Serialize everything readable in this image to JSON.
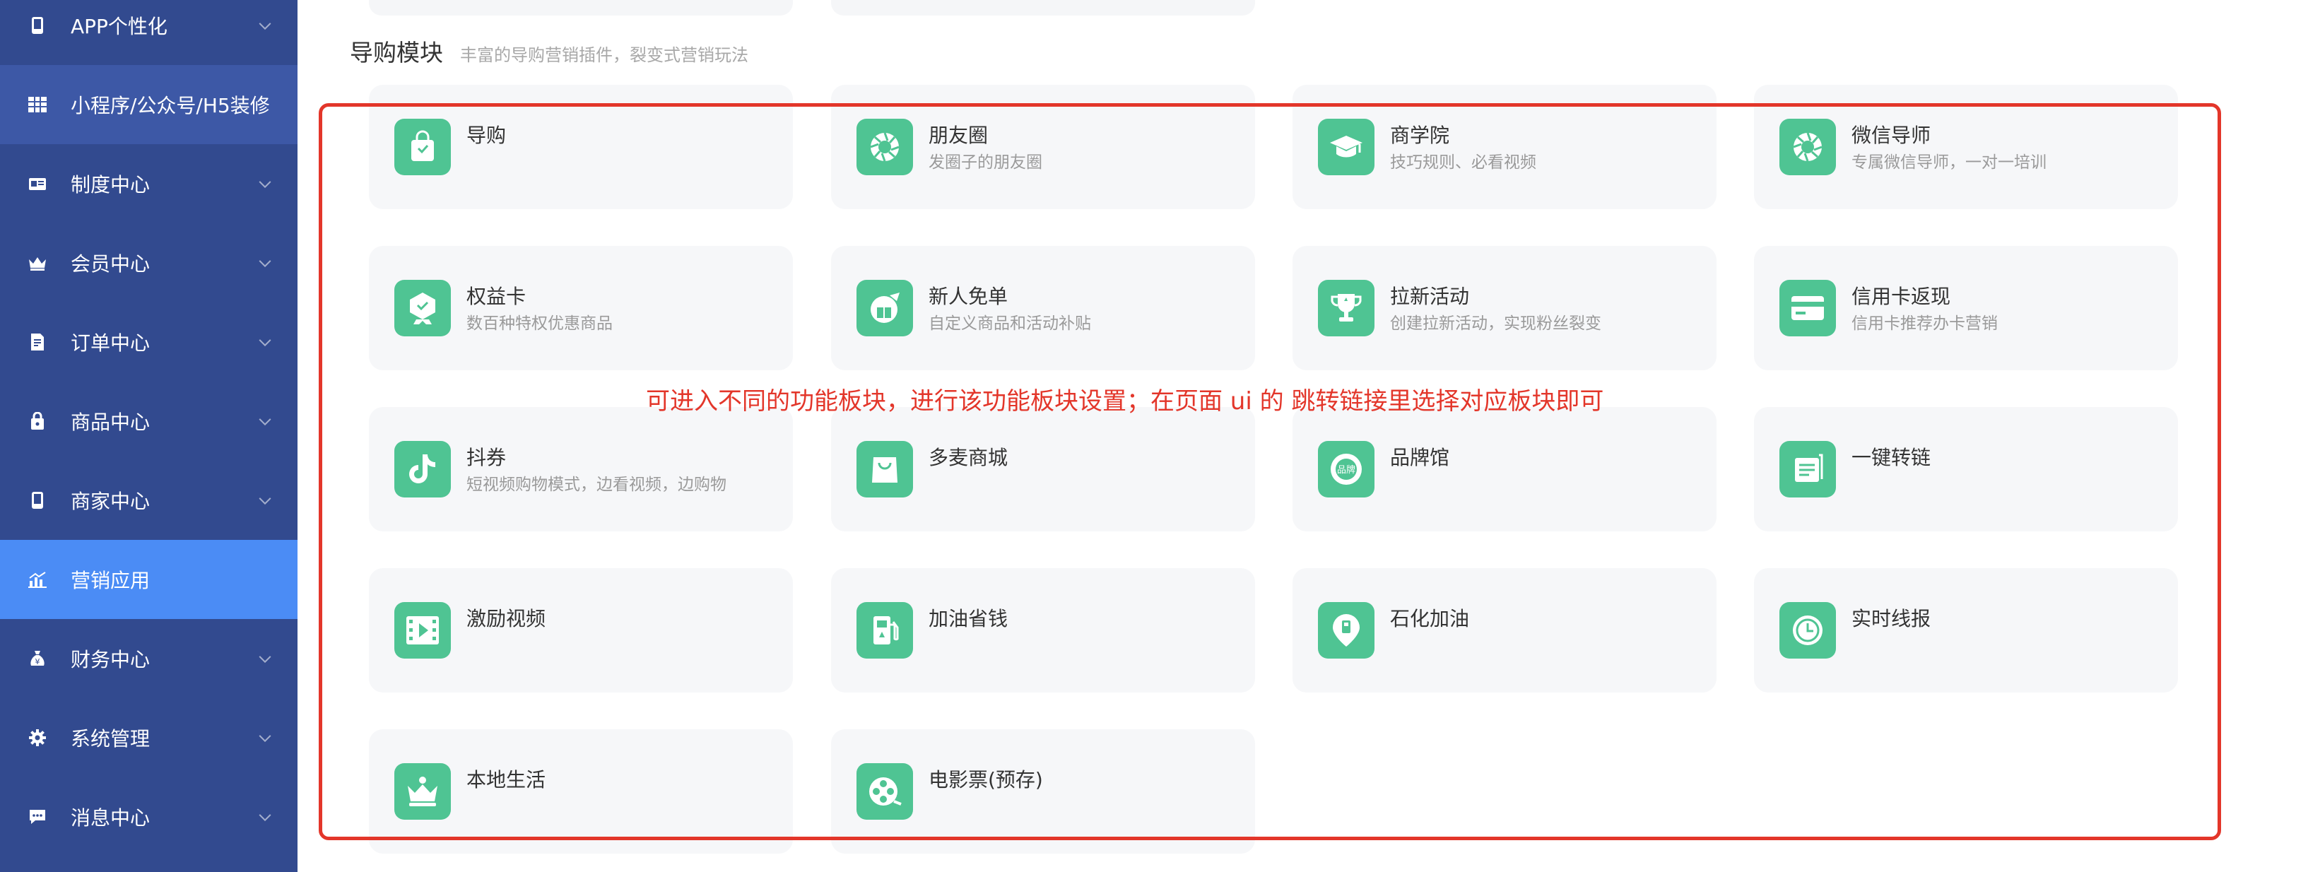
{
  "sidebar": {
    "items": [
      {
        "label": "APP个性化",
        "icon": "phone-icon",
        "chevron": true
      },
      {
        "label": "小程序/公众号/H5装修",
        "icon": "grid-icon",
        "chevron": false
      },
      {
        "label": "制度中心",
        "icon": "id-card-icon",
        "chevron": true
      },
      {
        "label": "会员中心",
        "icon": "crown-icon",
        "chevron": true
      },
      {
        "label": "订单中心",
        "icon": "document-icon",
        "chevron": true
      },
      {
        "label": "商品中心",
        "icon": "bag-icon",
        "chevron": true
      },
      {
        "label": "商家中心",
        "icon": "phone-icon",
        "chevron": true
      },
      {
        "label": "营销应用",
        "icon": "chart-icon",
        "chevron": false,
        "active": true
      },
      {
        "label": "财务中心",
        "icon": "money-bag-icon",
        "chevron": true
      },
      {
        "label": "系统管理",
        "icon": "gear-icon",
        "chevron": true
      },
      {
        "label": "消息中心",
        "icon": "chat-icon",
        "chevron": true
      }
    ]
  },
  "section": {
    "title": "导购模块",
    "subtitle": "丰富的导购营销插件，裂变式营销玩法"
  },
  "cards": [
    {
      "title": "导购",
      "desc": "",
      "icon": "shopping-bag-icon"
    },
    {
      "title": "朋友圈",
      "desc": "发圈子的朋友圈",
      "icon": "aperture-icon"
    },
    {
      "title": "商学院",
      "desc": "技巧规则、必看视频",
      "icon": "graduation-cap-icon"
    },
    {
      "title": "微信导师",
      "desc": "专属微信导师，一对一培训",
      "icon": "aperture-icon"
    },
    {
      "title": "权益卡",
      "desc": "数百种特权优惠商品",
      "icon": "badge-icon"
    },
    {
      "title": "新人免单",
      "desc": "自定义商品和活动补贴",
      "icon": "gift-icon"
    },
    {
      "title": "拉新活动",
      "desc": "创建拉新活动，实现粉丝裂变",
      "icon": "trophy-icon"
    },
    {
      "title": "信用卡返现",
      "desc": "信用卡推荐办卡营销",
      "icon": "credit-card-icon"
    },
    {
      "title": "抖券",
      "desc": "短视频购物模式，边看视频，边购物",
      "icon": "tiktok-icon"
    },
    {
      "title": "多麦商城",
      "desc": "",
      "icon": "shopping-bag-icon"
    },
    {
      "title": "品牌馆",
      "desc": "",
      "icon": "brand-icon"
    },
    {
      "title": "一键转链",
      "desc": "",
      "icon": "list-icon"
    },
    {
      "title": "激励视频",
      "desc": "",
      "icon": "film-icon"
    },
    {
      "title": "加油省钱",
      "desc": "",
      "icon": "fuel-icon"
    },
    {
      "title": "石化加油",
      "desc": "",
      "icon": "location-pin-icon"
    },
    {
      "title": "实时线报",
      "desc": "",
      "icon": "clock-icon"
    },
    {
      "title": "本地生活",
      "desc": "",
      "icon": "crown-icon"
    },
    {
      "title": "电影票(预存)",
      "desc": "",
      "icon": "film-reel-icon"
    }
  ],
  "annotation": "可进入不同的功能板块，进行该功能板块设置；在页面 ui 的 跳转链接里选择对应板块即可",
  "colors": {
    "sidebar_bg": "#324a8f",
    "sidebar_active": "#4b8cf5",
    "icon_green": "#4fc493",
    "annotation_red": "#e3362a",
    "card_bg": "#f6f7f9"
  }
}
